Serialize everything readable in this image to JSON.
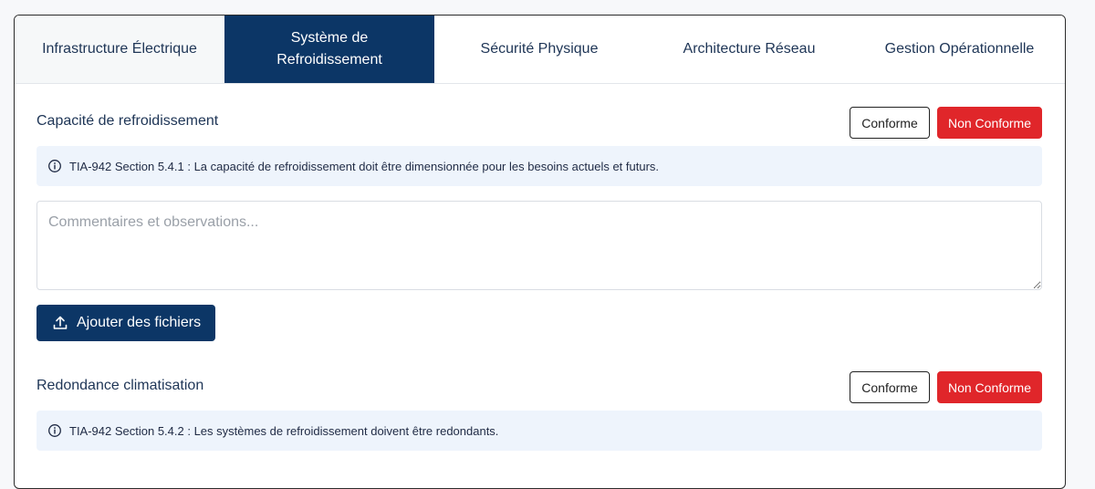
{
  "tabs": [
    {
      "label": "Infrastructure Électrique",
      "active": false
    },
    {
      "label": "Système de Refroidissement",
      "active": true
    },
    {
      "label": "Sécurité Physique",
      "active": false
    },
    {
      "label": "Architecture Réseau",
      "active": false
    },
    {
      "label": "Gestion Opérationnelle",
      "active": false
    }
  ],
  "sections": [
    {
      "title": "Capacité de refroidissement",
      "conforme_label": "Conforme",
      "non_conforme_label": "Non Conforme",
      "info_text": "TIA-942 Section 5.4.1 : La capacité de refroidissement doit être dimensionnée pour les besoins actuels et futurs.",
      "comments_placeholder": "Commentaires et observations...",
      "upload_label": "Ajouter des fichiers"
    },
    {
      "title": "Redondance climatisation",
      "conforme_label": "Conforme",
      "non_conforme_label": "Non Conforme",
      "info_text": "TIA-942 Section 5.4.2 : Les systèmes de refroidissement doivent être redondants."
    }
  ],
  "icons": {
    "info": "info-circle-icon",
    "upload": "upload-icon"
  },
  "colors": {
    "primary": "#0c3666",
    "danger": "#e0262a",
    "info_bg": "#eef4fc"
  }
}
